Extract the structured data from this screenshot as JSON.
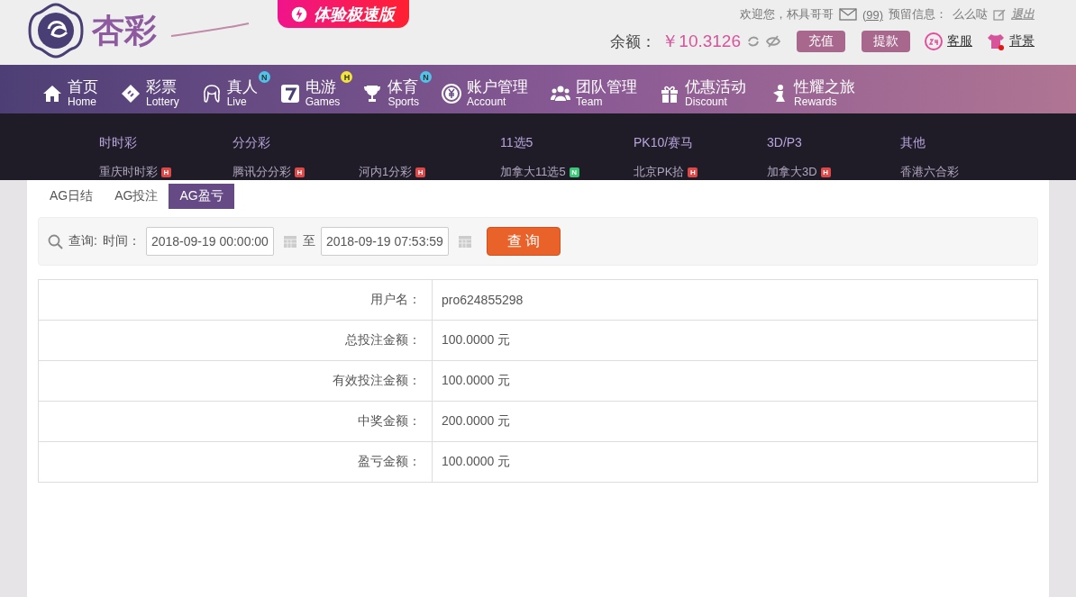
{
  "header": {
    "logo_text": "杏彩",
    "promo_button": "体验极速版",
    "user_bar": {
      "welcome": "欢迎您，杯具哥哥",
      "messages": "(99)",
      "reserved_label": "预留信息：",
      "reserved_value": "么么哒",
      "logout": "退出"
    },
    "balance": {
      "label": "余额：",
      "amount": "￥10.3126"
    },
    "actions": [
      "充值",
      "提款"
    ],
    "links": [
      {
        "kind": "service",
        "label": "客服"
      },
      {
        "kind": "skin",
        "label": "背景"
      }
    ]
  },
  "nav": [
    {
      "kind": "home",
      "label": "首页",
      "sub": "Home"
    },
    {
      "kind": "ticket",
      "label": "彩票",
      "sub": "Lottery"
    },
    {
      "kind": "lady",
      "label": "真人",
      "sub": "Live",
      "badge": {
        "text": "N",
        "color": "#4fc3ea"
      }
    },
    {
      "kind": "seven",
      "label": "电游",
      "sub": "Games",
      "badge": {
        "text": "H",
        "color": "#f3e43c"
      }
    },
    {
      "kind": "trophy",
      "label": "体育",
      "sub": "Sports",
      "badge": {
        "text": "N",
        "color": "#4fc3ea"
      }
    },
    {
      "kind": "yen",
      "label": "账户管理",
      "sub": "Account"
    },
    {
      "kind": "team",
      "label": "团队管理",
      "sub": "Team"
    },
    {
      "kind": "gift",
      "label": "优惠活动",
      "sub": "Discount"
    },
    {
      "kind": "figure",
      "label": "性耀之旅",
      "sub": "Rewards"
    }
  ],
  "dropdown": [
    {
      "heading": "时时彩",
      "items": [
        {
          "label": "重庆时时彩",
          "badge": {
            "text": "H",
            "color": "#e04848"
          }
        }
      ]
    },
    {
      "heading": "分分彩",
      "items": [
        {
          "label": "腾讯分分彩",
          "badge": {
            "text": "H",
            "color": "#e04848"
          }
        }
      ]
    },
    {
      "items": [
        {
          "label": "河内1分彩",
          "badge": {
            "text": "H",
            "color": "#e04848"
          }
        }
      ]
    },
    {
      "heading": "11选5",
      "items": [
        {
          "label": "加拿大11选5",
          "badge": {
            "text": "N",
            "color": "#3cc878"
          }
        }
      ]
    },
    {
      "heading": "PK10/赛马",
      "items": [
        {
          "label": "北京PK拾",
          "badge": {
            "text": "H",
            "color": "#e04848"
          }
        }
      ]
    },
    {
      "heading": "3D/P3",
      "items": [
        {
          "label": "加拿大3D",
          "badge": {
            "text": "H",
            "color": "#e04848"
          }
        }
      ]
    },
    {
      "heading": "其他",
      "items": [
        {
          "label": "香港六合彩"
        }
      ]
    }
  ],
  "tabs": [
    {
      "label": "AG日结",
      "selected": false
    },
    {
      "label": "AG投注",
      "selected": false
    },
    {
      "label": "AG盈亏",
      "selected": true
    }
  ],
  "search": {
    "label": "查询:",
    "time_label": "时间：",
    "start": "2018-09-19 00:00:00",
    "separator": "至",
    "end": "2018-09-19 07:53:59",
    "button": "查 询"
  },
  "table": {
    "rows": [
      {
        "label": "用户名：",
        "value": "pro624855298"
      },
      {
        "label": "总投注金额：",
        "value": "100.0000 元"
      },
      {
        "label": "有效投注金额：",
        "value": "100.0000 元"
      },
      {
        "label": "中奖金额：",
        "value": "200.0000 元"
      },
      {
        "label": "盈亏金额：",
        "value": "100.0000 元"
      }
    ]
  }
}
